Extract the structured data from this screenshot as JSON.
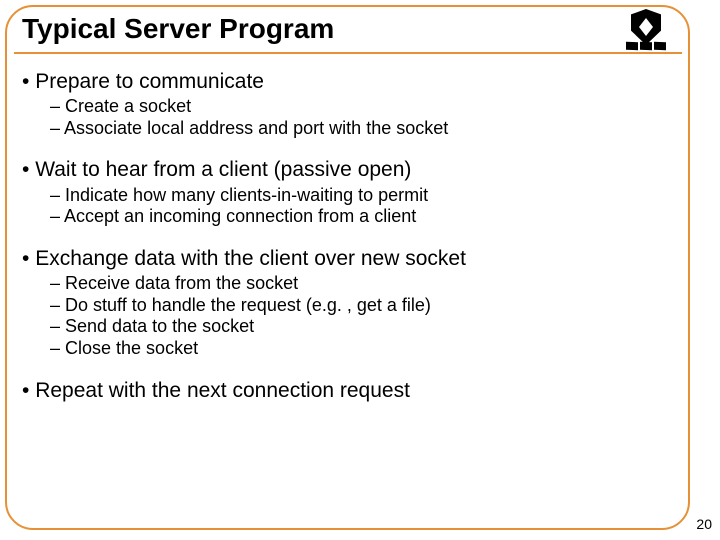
{
  "title": "Typical Server Program",
  "page_number": "20",
  "sections": [
    {
      "main": "Prepare to communicate",
      "subs": [
        "Create a socket",
        "Associate local address and port with the socket"
      ]
    },
    {
      "main": "Wait to hear from a client (passive open)",
      "subs": [
        "Indicate how many clients-in-waiting to permit",
        "Accept an incoming connection from a client"
      ]
    },
    {
      "main": "Exchange data with the client over new socket",
      "subs": [
        "Receive data from the socket",
        "Do stuff to handle the request (e.g. , get a file)",
        "Send data to the socket",
        "Close the socket"
      ]
    },
    {
      "main": "Repeat with the next connection request",
      "subs": []
    }
  ]
}
